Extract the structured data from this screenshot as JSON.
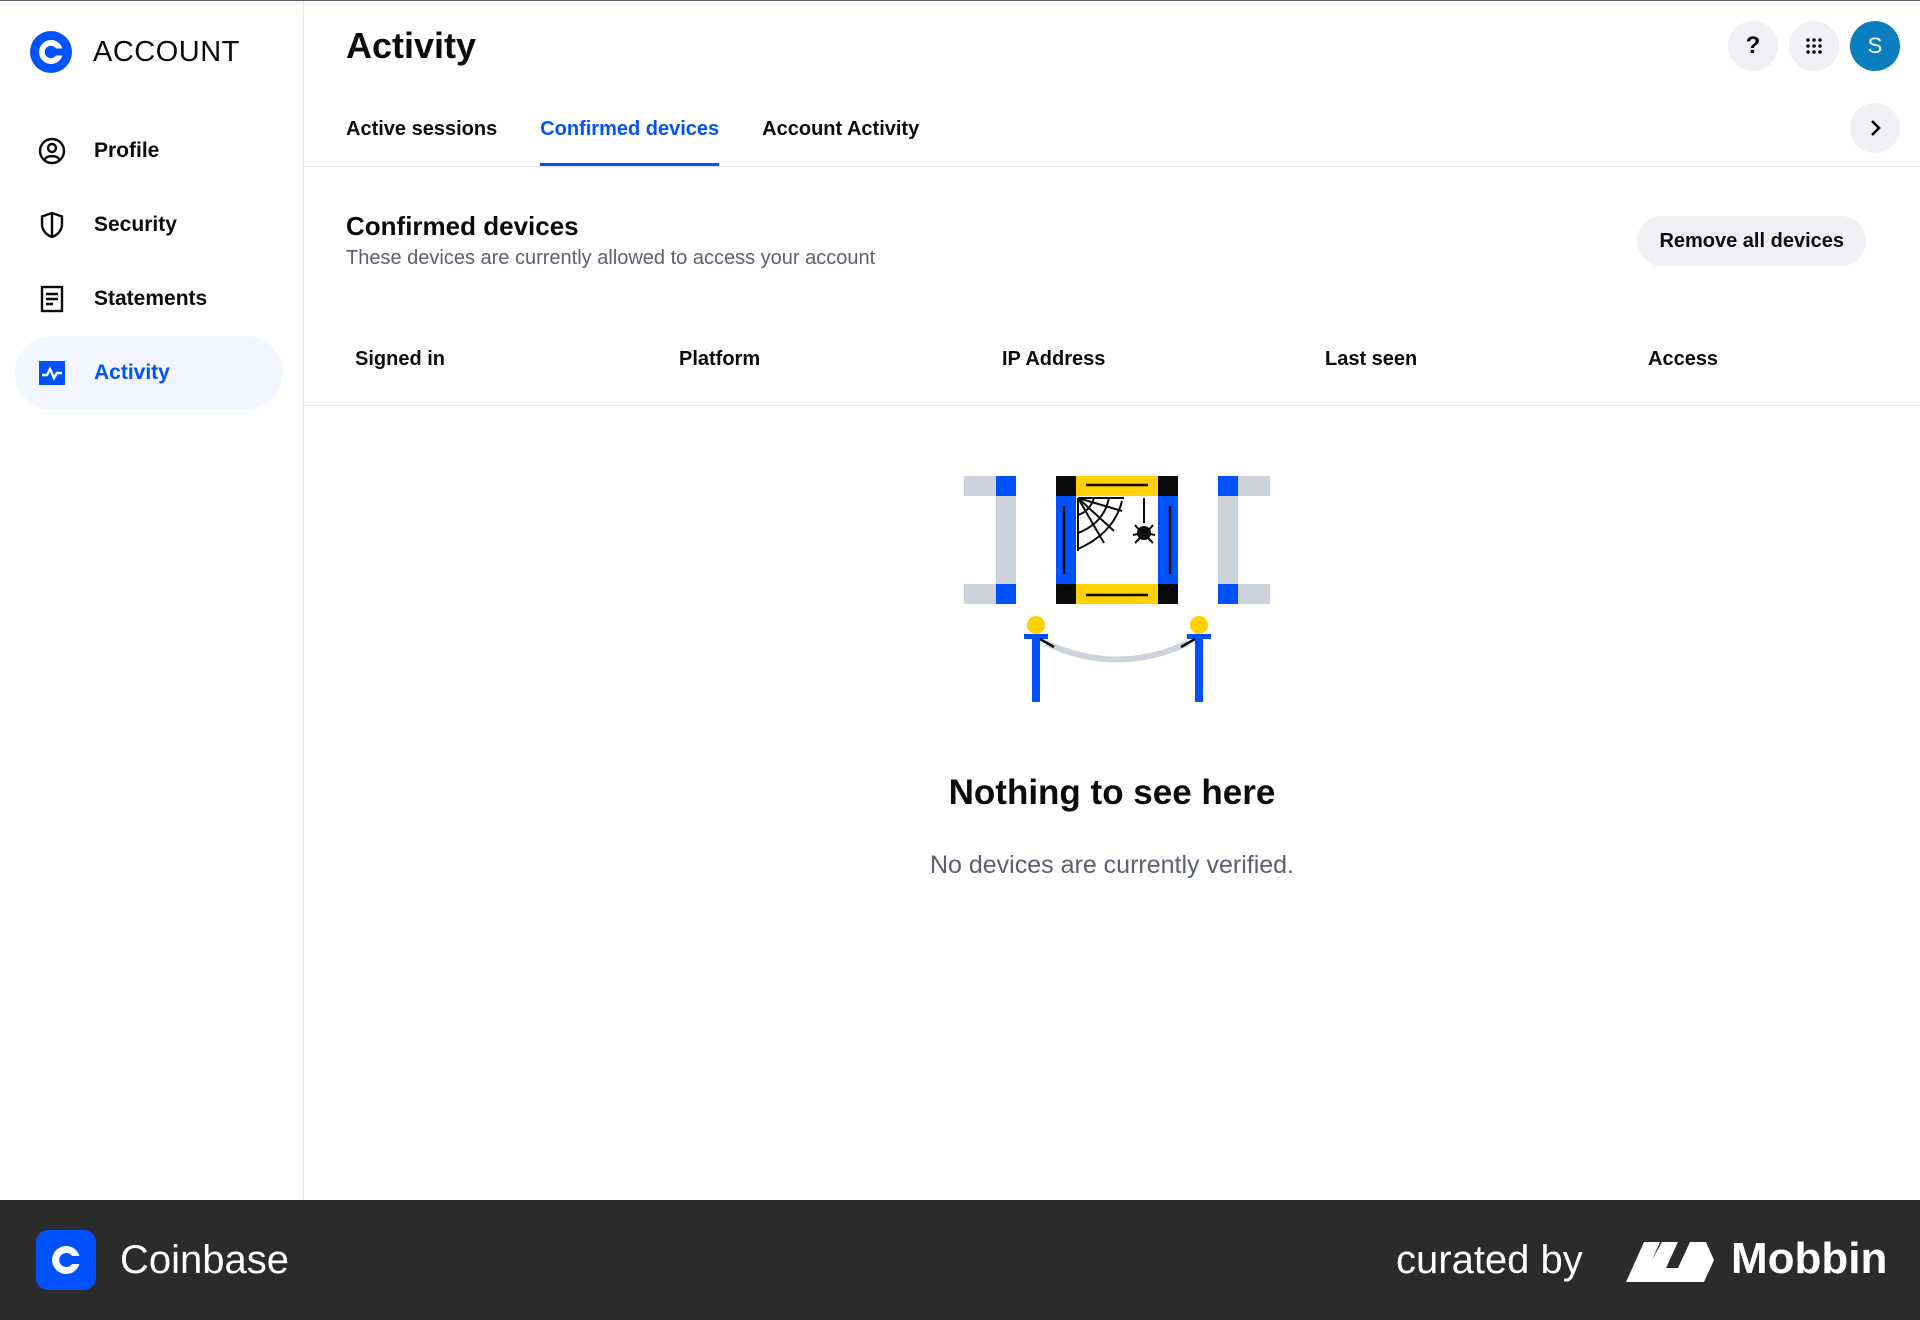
{
  "sidebar": {
    "brand": "ACCOUNT",
    "items": [
      {
        "label": "Profile",
        "icon": "user-circle-icon"
      },
      {
        "label": "Security",
        "icon": "shield-icon"
      },
      {
        "label": "Statements",
        "icon": "document-icon"
      },
      {
        "label": "Activity",
        "icon": "activity-chart-icon",
        "active": true
      }
    ]
  },
  "header": {
    "title": "Activity",
    "help_label": "?",
    "apps_icon": "grid-icon",
    "avatar_initial": "S"
  },
  "tabs": [
    {
      "label": "Active sessions"
    },
    {
      "label": "Confirmed devices",
      "active": true
    },
    {
      "label": "Account Activity"
    }
  ],
  "section": {
    "title": "Confirmed devices",
    "subtitle": "These devices are currently allowed to access your account",
    "remove_all_label": "Remove all devices"
  },
  "table": {
    "columns": [
      "Signed in",
      "Platform",
      "IP Address",
      "Last seen",
      "Access"
    ]
  },
  "empty_state": {
    "title": "Nothing to see here",
    "message": "No devices are currently verified."
  },
  "footer": {
    "brand": "Coinbase",
    "curated_by": "curated by",
    "mobbin": "Mobbin"
  },
  "colors": {
    "accent": "#0052ff",
    "active_bg": "#f3f6fd",
    "footer_bg": "#2b2b2b",
    "avatar_bg": "#0a7ebf",
    "illustration_yellow": "#ffd100"
  }
}
